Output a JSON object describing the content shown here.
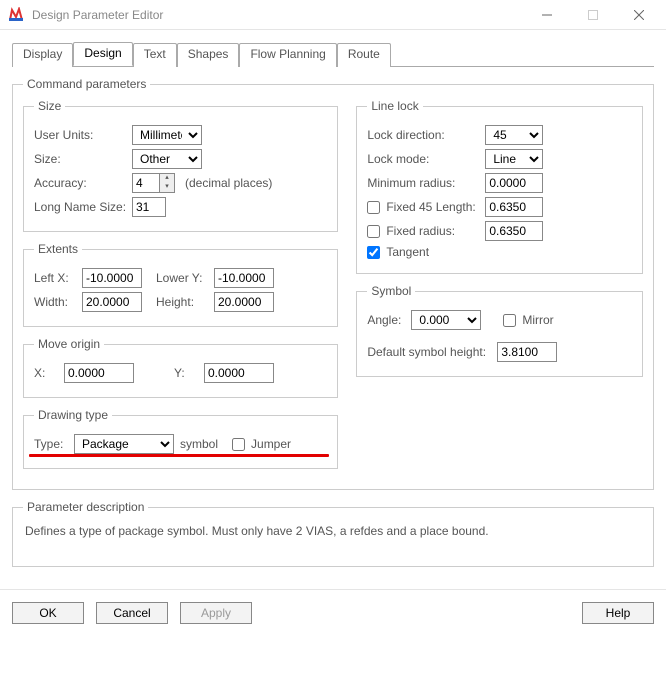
{
  "window": {
    "title": "Design Parameter Editor"
  },
  "tabs": [
    "Display",
    "Design",
    "Text",
    "Shapes",
    "Flow Planning",
    "Route"
  ],
  "active_tab": 1,
  "groups": {
    "command": "Command parameters",
    "size": "Size",
    "extents": "Extents",
    "move_origin": "Move origin",
    "drawing_type": "Drawing type",
    "line_lock": "Line lock",
    "symbol": "Symbol",
    "param_desc": "Parameter description"
  },
  "size": {
    "user_units_label": "User Units:",
    "user_units": "Millimeter",
    "size_label": "Size:",
    "size": "Other",
    "accuracy_label": "Accuracy:",
    "accuracy": "4",
    "decimal_places": "(decimal places)",
    "long_name_label": "Long Name Size:",
    "long_name": "31"
  },
  "extents": {
    "leftx_label": "Left X:",
    "leftx": "-10.0000",
    "lowery_label": "Lower Y:",
    "lowery": "-10.0000",
    "width_label": "Width:",
    "width": "20.0000",
    "height_label": "Height:",
    "height": "20.0000"
  },
  "move_origin": {
    "x_label": "X:",
    "x": "0.0000",
    "y_label": "Y:",
    "y": "0.0000"
  },
  "drawing_type": {
    "type_label": "Type:",
    "type": "Package",
    "symbol_suffix": "symbol",
    "jumper_label": "Jumper"
  },
  "line_lock": {
    "direction_label": "Lock direction:",
    "direction": "45",
    "mode_label": "Lock mode:",
    "mode": "Line",
    "min_radius_label": "Minimum radius:",
    "min_radius": "0.0000",
    "fixed45_label": "Fixed 45 Length:",
    "fixed45": "0.6350",
    "fixed_radius_label": "Fixed radius:",
    "fixed_radius": "0.6350",
    "tangent_label": "Tangent",
    "tangent_checked": true
  },
  "symbol": {
    "angle_label": "Angle:",
    "angle": "0.000",
    "mirror_label": "Mirror",
    "default_height_label": "Default symbol height:",
    "default_height": "3.8100"
  },
  "param_desc_text": "Defines a type of package symbol.  Must only have 2 VIAS, a refdes and a place bound.",
  "buttons": {
    "ok": "OK",
    "cancel": "Cancel",
    "apply": "Apply",
    "help": "Help"
  }
}
